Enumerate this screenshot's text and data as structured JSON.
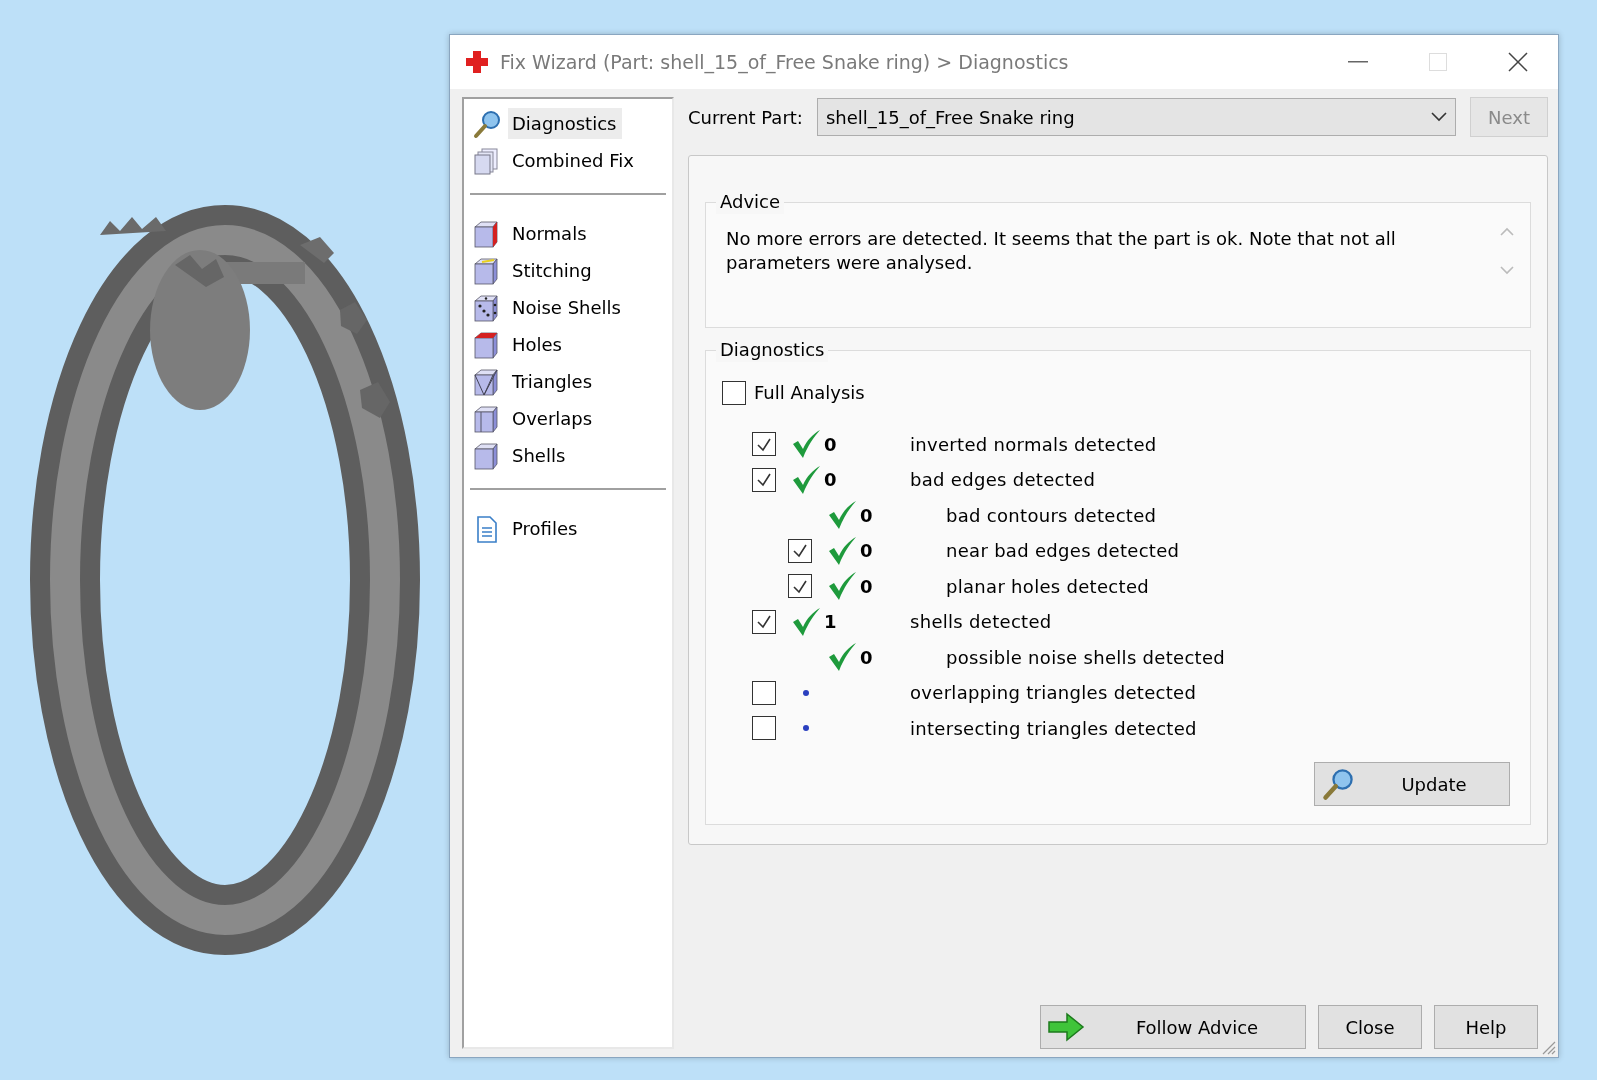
{
  "window": {
    "title": "Fix Wizard (Part: shell_15_of_Free Snake ring) > Diagnostics"
  },
  "sidebar": {
    "groups": [
      {
        "items": [
          {
            "label": "Diagnostics",
            "selected": true
          },
          {
            "label": "Combined Fix",
            "selected": false
          }
        ]
      },
      {
        "items": [
          {
            "label": "Normals",
            "selected": false
          },
          {
            "label": "Stitching",
            "selected": false
          },
          {
            "label": "Noise Shells",
            "selected": false
          },
          {
            "label": "Holes",
            "selected": false
          },
          {
            "label": "Triangles",
            "selected": false
          },
          {
            "label": "Overlaps",
            "selected": false
          },
          {
            "label": "Shells",
            "selected": false
          }
        ]
      },
      {
        "items": [
          {
            "label": "Profiles",
            "selected": false
          }
        ]
      }
    ]
  },
  "current_part": {
    "label": "Current Part:",
    "value": "shell_15_of_Free Snake ring"
  },
  "next_button": {
    "label": "Next",
    "disabled": true
  },
  "advice": {
    "title": "Advice",
    "text": "No more errors are detected. It seems that the part is ok. Note that not all parameters were analysed."
  },
  "diagnostics": {
    "title": "Diagnostics",
    "full_analysis": {
      "label": "Full Analysis",
      "checked": false
    },
    "rows": [
      {
        "checked": true,
        "passed": true,
        "count": "0",
        "label": "inverted normals detected"
      },
      {
        "checked": true,
        "passed": true,
        "count": "0",
        "label": "bad edges detected",
        "children": [
          {
            "passed": true,
            "count": "0",
            "label": "bad contours detected"
          },
          {
            "checked": true,
            "passed": true,
            "count": "0",
            "label": "near bad edges detected"
          },
          {
            "checked": true,
            "passed": true,
            "count": "0",
            "label": "planar holes detected"
          }
        ]
      },
      {
        "checked": true,
        "passed": true,
        "count": "1",
        "label": "shells detected",
        "children": [
          {
            "passed": true,
            "count": "0",
            "label": "possible noise shells detected"
          }
        ]
      },
      {
        "checked": false,
        "passed": false,
        "label": "overlapping triangles detected"
      },
      {
        "checked": false,
        "passed": false,
        "label": "intersecting triangles detected"
      }
    ],
    "update_button": "Update"
  },
  "footer_buttons": [
    {
      "kind": "follow",
      "label": "Follow Advice"
    },
    {
      "kind": "plain",
      "label": "Close"
    },
    {
      "kind": "plain",
      "label": "Help"
    }
  ]
}
